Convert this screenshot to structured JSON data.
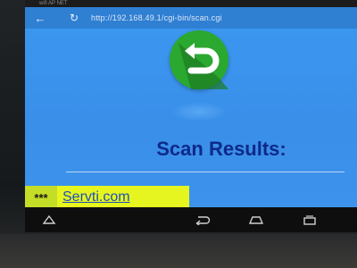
{
  "statusbar": {
    "text": "wifi AP NET"
  },
  "browser": {
    "url": "http://192.168.49.1/cgi-bin/scan.cgi"
  },
  "page": {
    "heading": "Scan Results:",
    "results": [
      {
        "marker": "***",
        "name": "Servti.com"
      }
    ]
  },
  "icons": {
    "back": "back-arrow-icon",
    "refresh": "refresh-icon",
    "logo": "green-circle-return-arrow-logo",
    "nav": [
      "collapse-icon",
      "back-icon",
      "home-icon",
      "recent-apps-icon"
    ]
  },
  "colors": {
    "toolbar": "#2f7fd3",
    "page_background": "#3b96f0",
    "heading": "#0d2a8a",
    "highlight": "#e6f51f",
    "logo_green": "#2ba82f"
  }
}
